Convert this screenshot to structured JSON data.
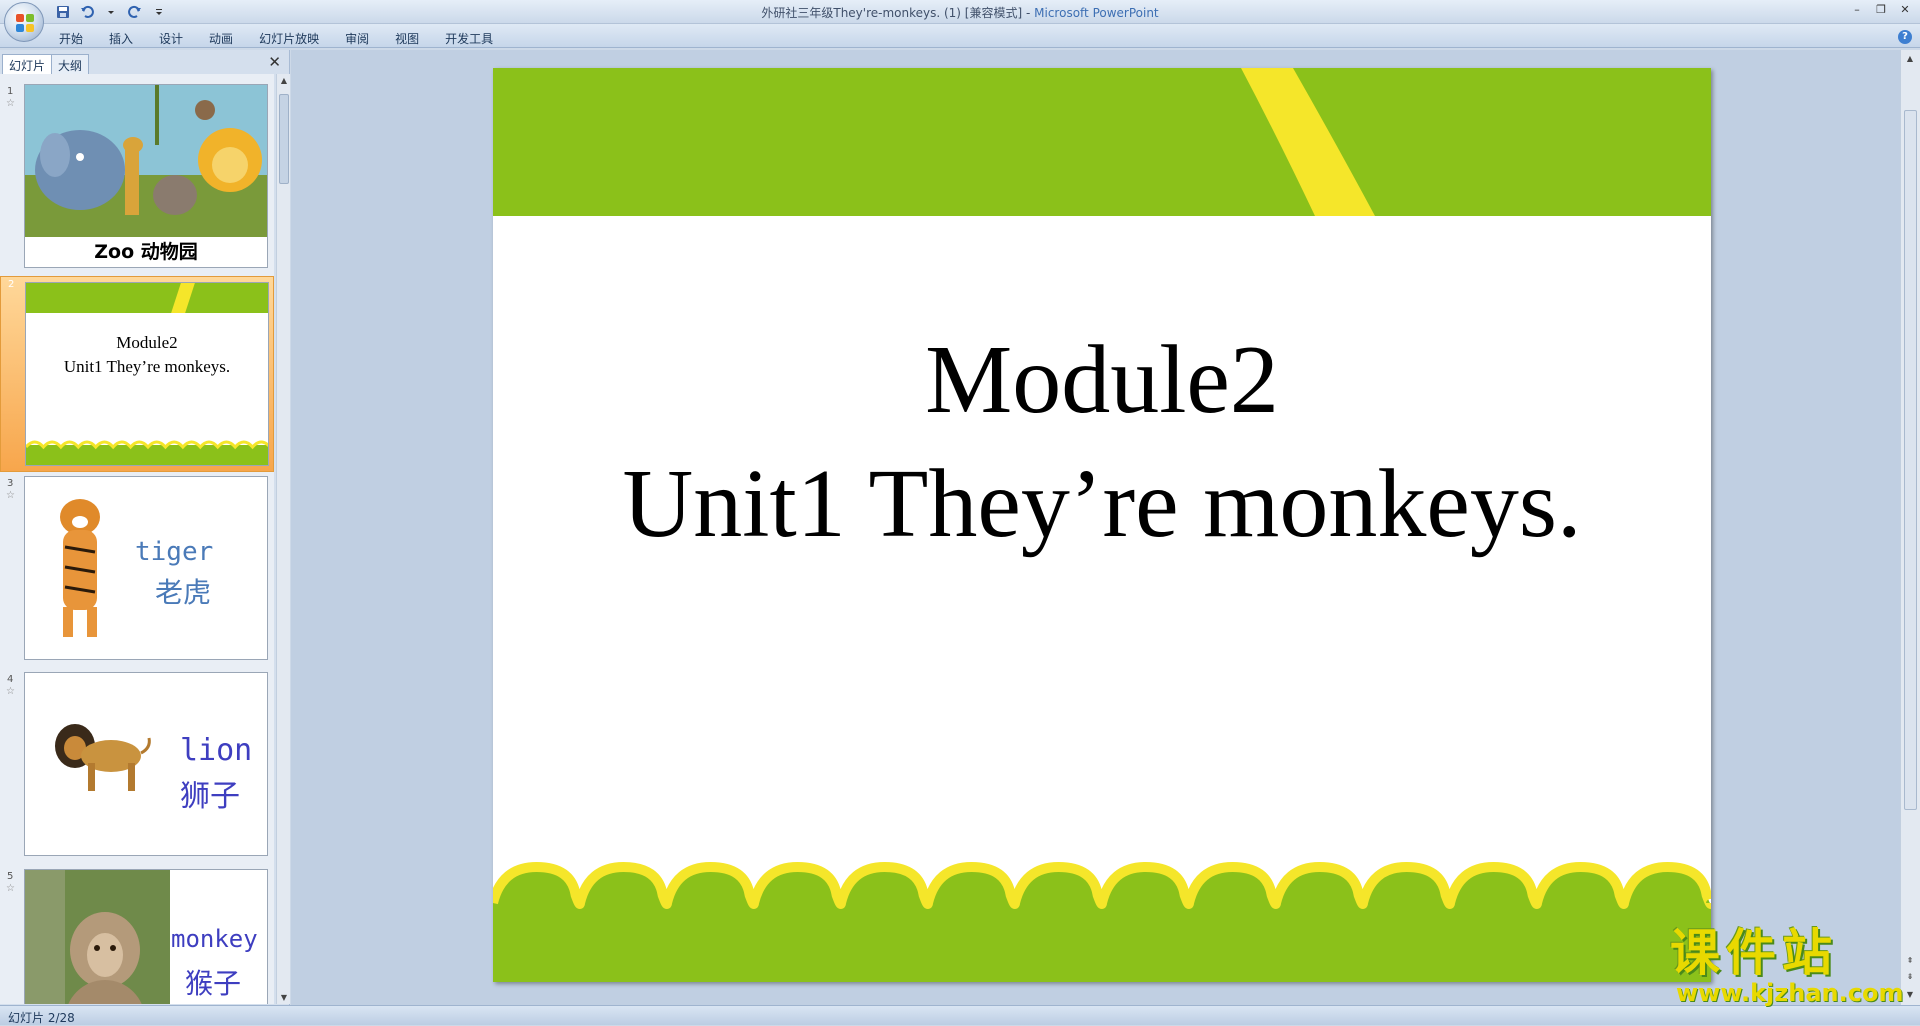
{
  "window": {
    "title_doc": "外研社三年级They're-monkeys. (1) [兼容模式]",
    "title_sep": " - ",
    "title_app": "Microsoft PowerPoint",
    "controls": [
      "–",
      "❐",
      "✕"
    ]
  },
  "ribbon": {
    "tabs": [
      "开始",
      "插入",
      "设计",
      "动画",
      "幻灯片放映",
      "审阅",
      "视图",
      "开发工具"
    ],
    "help_label": "?"
  },
  "panel": {
    "tabs": [
      "幻灯片",
      "大纲"
    ],
    "close_label": "✕",
    "thumbnails": [
      {
        "num": "1",
        "caption": "Zoo 动物园"
      },
      {
        "num": "2",
        "line1": "Module2",
        "line2": "Unit1 They’re monkeys."
      },
      {
        "num": "3",
        "word": "tiger",
        "cn": "老虎"
      },
      {
        "num": "4",
        "word": "lion",
        "cn": "狮子"
      },
      {
        "num": "5",
        "word": "monkey",
        "cn": "猴子"
      }
    ]
  },
  "slide": {
    "line1": "Module2",
    "line2": "Unit1 They’re monkeys.",
    "colors": {
      "green": "#8bc11a",
      "yellow": "#f5e62a",
      "bg": "#ffffff"
    }
  },
  "status": {
    "text": "幻灯片 2/28"
  },
  "watermark": {
    "cn": "课件站",
    "url": "www.kjzhan.com"
  }
}
